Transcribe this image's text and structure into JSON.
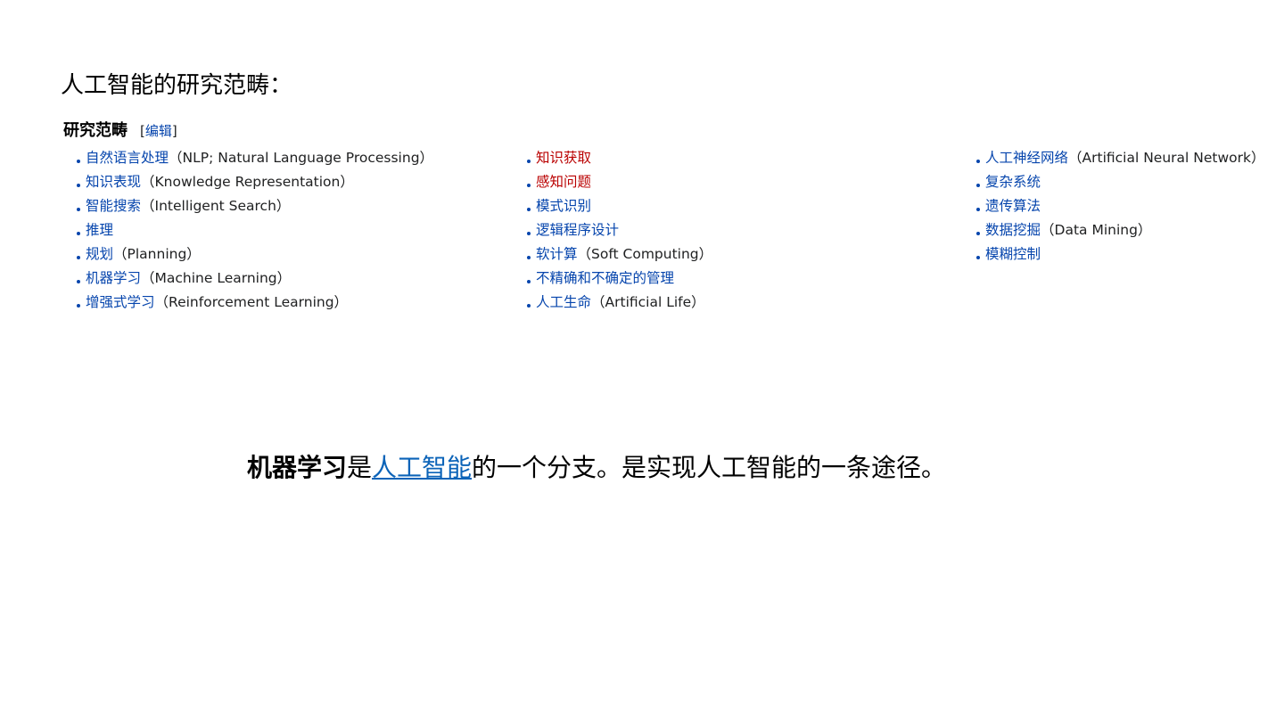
{
  "heading": "人工智能的研究范畴：",
  "section": {
    "title": "研究范畴",
    "edit_open": "[",
    "edit_label": "编辑",
    "edit_close": "]"
  },
  "columns": [
    [
      {
        "link": "自然语言处理",
        "extra": "（NLP; Natural Language Processing）"
      },
      {
        "link": "知识表现",
        "extra": "（Knowledge Representation）"
      },
      {
        "link": "智能搜索",
        "extra": "（Intelligent Search）"
      },
      {
        "link": "推理",
        "extra": ""
      },
      {
        "link": "规划",
        "extra": "（Planning）"
      },
      {
        "link": "机器学习",
        "extra": "（Machine Learning）"
      },
      {
        "link": "增强式学习",
        "extra": "（Reinforcement Learning）"
      }
    ],
    [
      {
        "link": "知识获取",
        "extra": ""
      },
      {
        "link": "感知问题",
        "extra": ""
      },
      {
        "link": "模式识别",
        "extra": ""
      },
      {
        "link": "逻辑程序设计",
        "extra": ""
      },
      {
        "link": "软计算",
        "extra": "（Soft Computing）"
      },
      {
        "link": "不精确和不确定的管理",
        "extra": ""
      },
      {
        "link": "人工生命",
        "extra": "（Artificial Life）"
      }
    ],
    [
      {
        "link": "人工神经网络",
        "extra": "（Artificial Neural Network）"
      },
      {
        "link": "复杂系统",
        "extra": ""
      },
      {
        "link": "遗传算法",
        "extra": ""
      },
      {
        "link": "数据挖掘",
        "extra": "（Data Mining）"
      },
      {
        "link": "模糊控制",
        "extra": ""
      }
    ]
  ],
  "sentence": {
    "bold": "机器学习",
    "part1": "是",
    "link": "人工智能",
    "part2": "的一个分支。是实现人工智能的一条途径。"
  },
  "colors": {
    "link": "#0645ad",
    "red_link": "#ba0000",
    "sentence_link": "#0b63b8"
  }
}
